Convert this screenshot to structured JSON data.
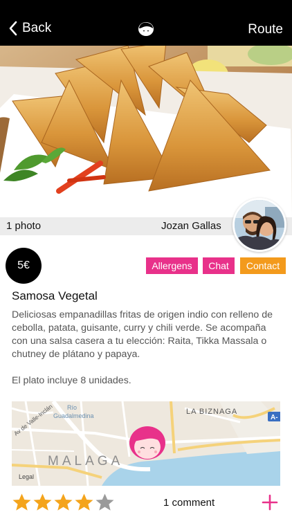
{
  "nav": {
    "back_label": "Back",
    "route_label": "Route"
  },
  "photo_bar": {
    "count": "1 photo",
    "author": "Jozan Gallas"
  },
  "dish": {
    "price": "5€",
    "title": "Samosa Vegetal",
    "description": "Deliciosas empanadillas fritas de origen indio con relleno de cebolla, patata, guisante, curry y chili verde. Se acompaña con una salsa casera a tu elección: Raita, Tikka Massala o chutney de plátano y papaya.",
    "note": "El plato incluye 8 unidades."
  },
  "tags": {
    "allergens": "Allergens",
    "chat": "Chat",
    "contact": "Contact"
  },
  "map": {
    "labels": {
      "rio": "Río",
      "guadalmedina": "Guadalmedina",
      "street": "Av de Valle-Inclán",
      "city": "MALAGA",
      "district": "LA BIZNAGA",
      "highway": "A-",
      "legal": "Legal"
    }
  },
  "rating": {
    "stars": 4,
    "max": 5,
    "comments": "1 comment"
  },
  "colors": {
    "pink": "#e8318a",
    "orange": "#f39a1c",
    "star": "#f4a41c"
  }
}
